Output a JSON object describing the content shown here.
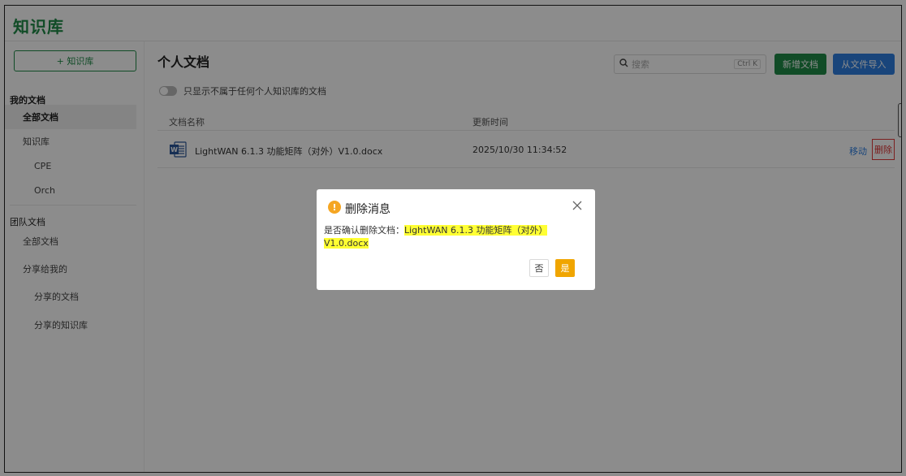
{
  "app": {
    "title": "知识库"
  },
  "sidebar": {
    "add_kb_label": "+ 知识库",
    "my_docs_heading": "我的文档",
    "all_docs": "全部文档",
    "kb_label": "知识库",
    "kb_items": [
      "CPE",
      "Orch"
    ],
    "team_docs_heading": "团队文档",
    "team_all_docs": "全部文档",
    "shared_with_me": "分享给我的",
    "shared_docs": "分享的文档",
    "shared_kb": "分享的知识库"
  },
  "main": {
    "title": "个人文档",
    "search": {
      "placeholder": "搜索",
      "shortcut": "Ctrl K"
    },
    "new_doc_label": "新增文档",
    "import_label": "从文件导入",
    "toggle_label": "只显示不属于任何个人知识库的文档",
    "columns": {
      "name": "文档名称",
      "time": "更新时间"
    },
    "rows": [
      {
        "name": "LightWAN 6.1.3 功能矩阵（对外）V1.0.docx",
        "updated": "2025/10/30 11:34:52",
        "move": "移动",
        "delete": "删除",
        "icon": "word-doc-icon"
      }
    ]
  },
  "dialog": {
    "title": "删除消息",
    "message_prefix": "是否确认删除文档：",
    "message_highlight_1": "LightWAN 6.1.3 功能矩阵（对外）",
    "message_highlight_2": "V1.0.docx",
    "no_label": "否",
    "yes_label": "是",
    "icon": "warning-icon"
  },
  "colors": {
    "brand_green": "#1f8a47",
    "import_blue": "#2f7fe0",
    "warning_orange": "#f5a623",
    "confirm_orange": "#f0a500",
    "highlight_yellow": "#ffff33"
  }
}
